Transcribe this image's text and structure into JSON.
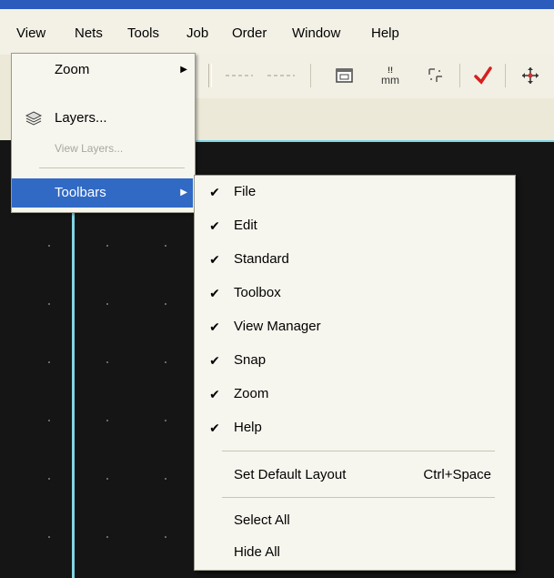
{
  "menubar": {
    "items": [
      {
        "label": "View"
      },
      {
        "label": "Nets"
      },
      {
        "label": "Tools"
      },
      {
        "label": "Job"
      },
      {
        "label": "Order"
      },
      {
        "label": "Window"
      },
      {
        "label": "Help"
      }
    ]
  },
  "toolbar": {
    "mm_label": "mm",
    "icons": [
      "properties-icon",
      "mm-units-icon",
      "grid-icon",
      "check-icon",
      "move-icon"
    ]
  },
  "view_menu": {
    "items": [
      {
        "label": "Zoom",
        "submenu": true,
        "enabled": true,
        "icon": ""
      },
      {
        "label": "Layers...",
        "submenu": false,
        "enabled": true,
        "icon": "layers-icon"
      },
      {
        "label": "View Layers...",
        "submenu": false,
        "enabled": false,
        "icon": ""
      },
      {
        "label": "Toolbars",
        "submenu": true,
        "enabled": true,
        "active": true,
        "icon": ""
      }
    ]
  },
  "toolbars_submenu": {
    "check_mark": "✔",
    "items": [
      {
        "label": "File",
        "checked": true
      },
      {
        "label": "Edit",
        "checked": true
      },
      {
        "label": "Standard",
        "checked": true
      },
      {
        "label": "Toolbox",
        "checked": true
      },
      {
        "label": "View Manager",
        "checked": true
      },
      {
        "label": "Snap",
        "checked": true
      },
      {
        "label": "Zoom",
        "checked": true
      },
      {
        "label": "Help",
        "checked": true
      }
    ],
    "default_layout": {
      "label": "Set Default Layout",
      "shortcut": "Ctrl+Space"
    },
    "select_all": {
      "label": "Select All"
    },
    "hide_all": {
      "label": "Hide All"
    }
  },
  "colors": {
    "highlight": "#316ac5",
    "canvas": "#151515",
    "guide_line": "#7fd6e6",
    "check_red": "#d62020"
  }
}
